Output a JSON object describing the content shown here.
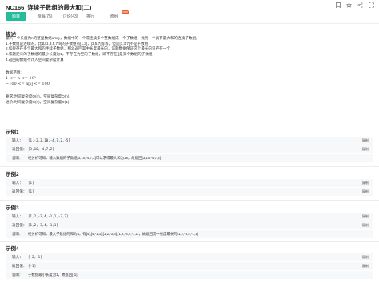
{
  "header": {
    "problem_id": "NC166",
    "problem_title": "连续子数组的最大和(二)",
    "icons": [
      "bookmark-icon",
      "star-icon",
      "share-icon",
      "fullscreen-icon"
    ]
  },
  "tabs": [
    {
      "label": "题目"
    },
    {
      "label": "题解(75)"
    },
    {
      "label": "讨论(43)"
    },
    {
      "label": "排行"
    },
    {
      "label": "面经"
    }
  ],
  "tab_badge": "new",
  "description": {
    "heading": "描述",
    "lines": [
      "输入一个长度为n的整型数组array，数组中的一个或连续多个整数组成一个子数组，找到一个具有最大和的连续子数组。",
      "1.子数组是连续的，比如[1,3,5,7,9]的子数组有[1,3]，[3,5,7]等等，但是[1,3,7]不是子数组",
      "2.如果存在多个最大和的连续子数组，那么返回其中长度最长的，该题数据保证这个最长的只存在一个",
      "3.该题定义的子数组的最小长度为1，不存在为空的子数组，即不存在[]是某个数组的子数组",
      "4.返回的数组不计入空间复杂度计算"
    ],
    "range_heading": "数据范围:",
    "range_1": "1 <= n <= 10⁵",
    "range_2": "−100 <= a[i] <= 100",
    "req_heading": "要求:时间复杂度O(n)，空间复杂度O(n)",
    "adv": "进阶:时间复杂度O(n)，空间复杂度O(1)"
  },
  "examples": [
    {
      "title": "示例1",
      "input_label": "输入：",
      "input": "[1,-2,3,10,-4,7,2,-5]",
      "output_label": "返回值：",
      "output": "[3,10,-4,7,2]",
      "note_label": "说明：",
      "note": "经分析可知，输入数组的子数组[3,10,-4,7,2]可以求得最大和为18，故返回[3,10,-4,7,2]",
      "copy": "复制"
    },
    {
      "title": "示例2",
      "input_label": "输入：",
      "input": "[1]",
      "output_label": "返回值：",
      "output": "[1]",
      "copy": "复制"
    },
    {
      "title": "示例3",
      "input_label": "输入：",
      "input": "[1,2,-3,4,-1,1,-3,2]",
      "output_label": "返回值：",
      "output": "[1,2,-3,4,-1,1]",
      "note_label": "说明：",
      "note": "经分析可知，最大子数组的和为4，有[4],[4,-1,1],[1,2,-3,4],[1,2,-3,4,-1,1]，故返回其中长度最长的[1,2,-3,4,-1,1]",
      "copy": "复制"
    },
    {
      "title": "示例4",
      "input_label": "输入：",
      "input": "[-2,-1]",
      "output_label": "返回值：",
      "output": "[-1]",
      "note_label": "说明：",
      "note": "子数组最小长度为1，故返回[-1]",
      "copy": "复制"
    }
  ],
  "colors": {
    "accent": "#25bb9b",
    "badge": "#f05a28"
  }
}
